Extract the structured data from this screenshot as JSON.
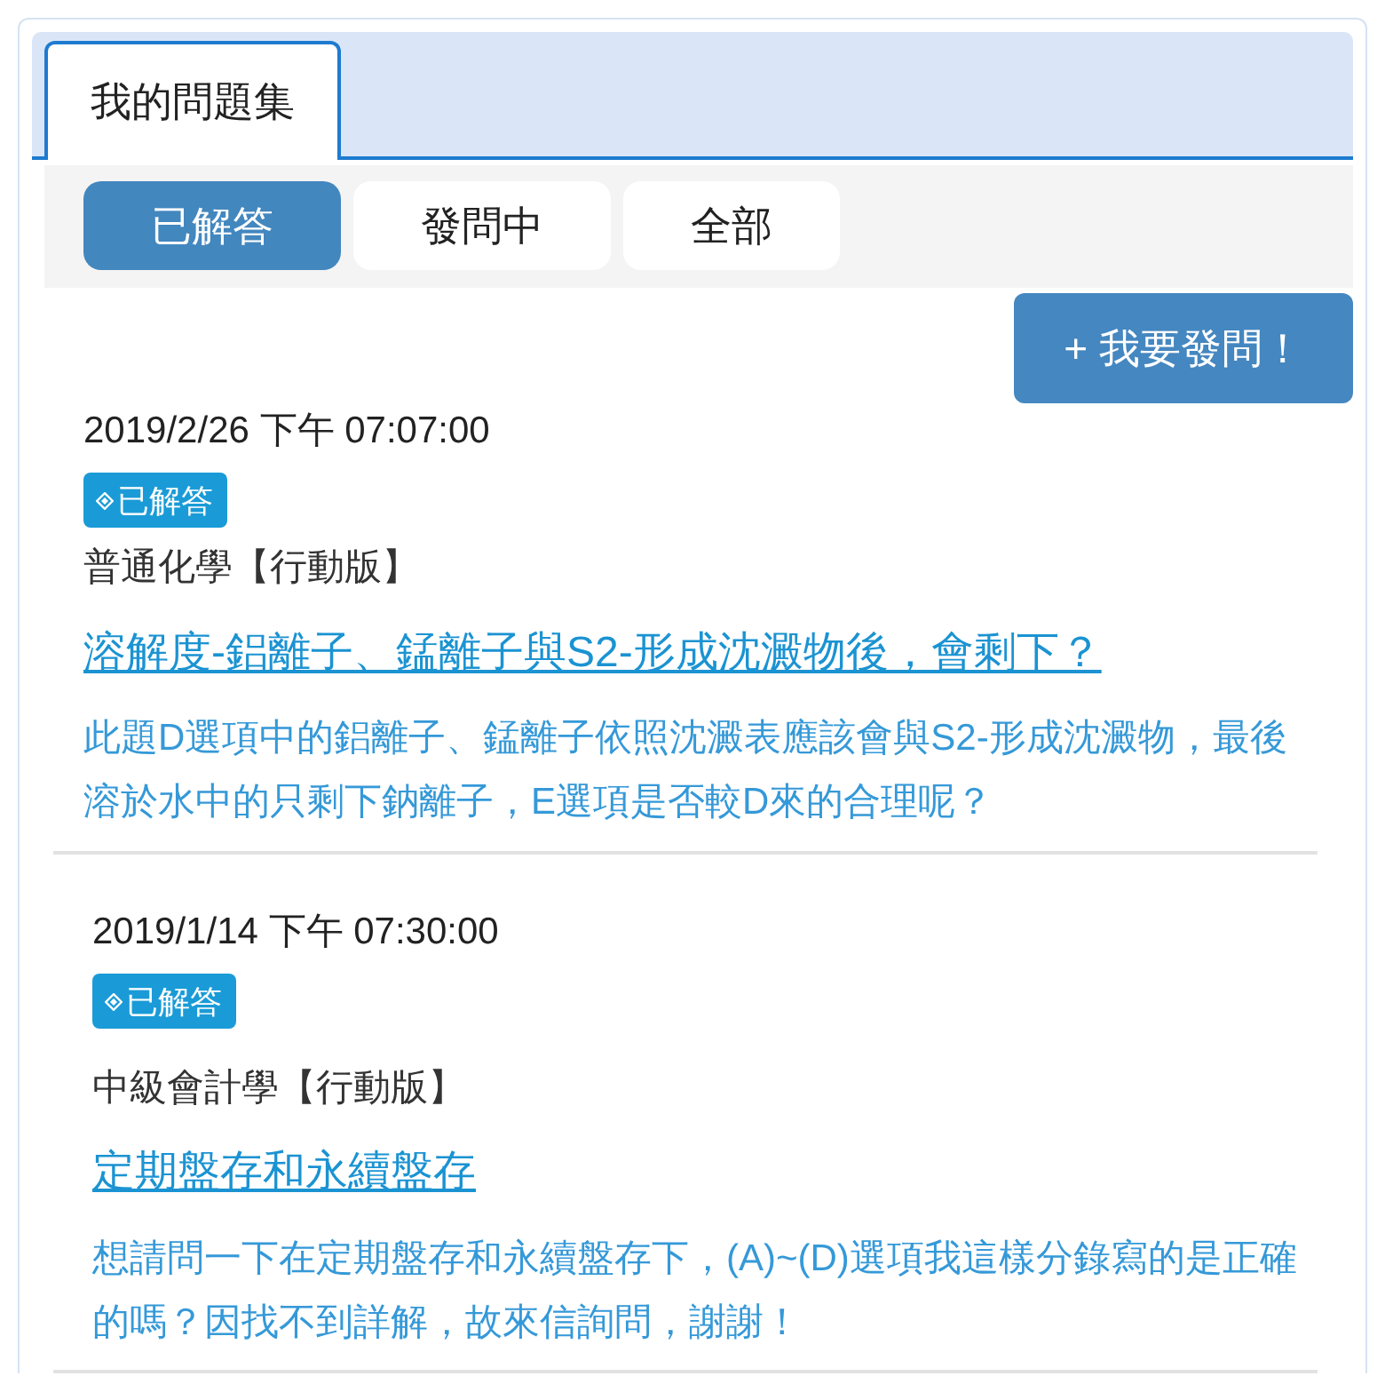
{
  "tabs": [
    {
      "label": "我的問題集",
      "selected": true
    }
  ],
  "filters": [
    {
      "label": "已解答",
      "selected": true
    },
    {
      "label": "發問中",
      "selected": false
    },
    {
      "label": "全部",
      "selected": false
    }
  ],
  "ask_button": {
    "label": "+ 我要發問！"
  },
  "questions": [
    {
      "date": "2019/2/26 下午 07:07:00",
      "status": "已解答",
      "subject": "普通化學【行動版】",
      "title": "溶解度-鋁離子、錳離子與S2-形成沈澱物後，會剩下？",
      "body": "此題D選項中的鋁離子、錳離子依照沈澱表應該會與S2-形成沈澱物，最後溶於水中的只剩下鈉離子，E選項是否較D來的合理呢？"
    },
    {
      "date": "2019/1/14 下午 07:30:00",
      "status": "已解答",
      "subject": "中級會計學【行動版】",
      "title": "定期盤存和永續盤存",
      "body": "想請問一下在定期盤存和永續盤存下，(A)~(D)選項我這樣分錄寫的是正確的嗎？因找不到詳解，故來信詢問，謝謝！"
    }
  ]
}
